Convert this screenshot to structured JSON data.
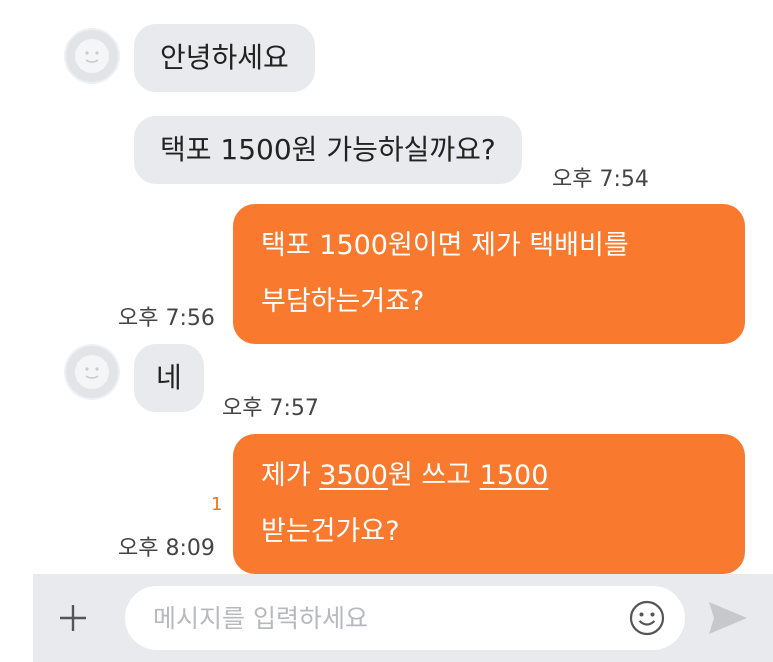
{
  "messages": [
    {
      "direction": "in",
      "text": "안녕하세요",
      "time": ""
    },
    {
      "direction": "in",
      "text": "택포 1500원 가능하실까요?",
      "time": "오후 7:54"
    },
    {
      "direction": "out",
      "line1": "택포 1500원이면 제가 택배비를",
      "line2": "부담하는거죠?",
      "time": "오후 7:56"
    },
    {
      "direction": "in",
      "text": "네",
      "time": "오후 7:57"
    },
    {
      "direction": "out",
      "line1_pre": "제가 ",
      "line1_amount1": "3500",
      "line1_mid": "원 쓰고 ",
      "line1_amount2": "1500",
      "line2": "받는건가요?",
      "time": "오후 8:09",
      "unread": "1"
    }
  ],
  "input": {
    "placeholder": "메시지를 입력하세요"
  },
  "icons": {
    "attach": "plus-icon",
    "emoji": "emoji-icon",
    "send": "send-icon",
    "avatar": "default-avatar-icon"
  },
  "colors": {
    "outgoing_bubble": "#f97a2e",
    "incoming_bubble": "#e9eaee",
    "unread_count": "#e07b2f"
  }
}
